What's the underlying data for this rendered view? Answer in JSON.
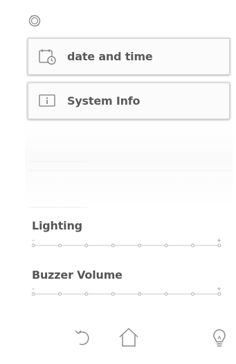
{
  "header": {
    "status_icon": "sync-icon"
  },
  "menu": {
    "items": [
      {
        "label": "date and time",
        "icon": "calendar-clock-icon"
      },
      {
        "label": "System Info",
        "icon": "info-icon"
      }
    ]
  },
  "lighting": {
    "title": "Lighting",
    "min_symbol": "–",
    "max_symbol": "+",
    "ticks": 8
  },
  "buzzer": {
    "title": "Buzzer Volume",
    "min_symbol": "–",
    "max_symbol": "+",
    "ticks": 8
  },
  "bottom_bar": {
    "icons": [
      "back-icon",
      "home-icon",
      "lightbulb-icon"
    ]
  },
  "colors": {
    "text": "#555555",
    "icon": "#7a7a7a",
    "button_border": "#d2d2d2",
    "track": "#c8c8c8"
  }
}
